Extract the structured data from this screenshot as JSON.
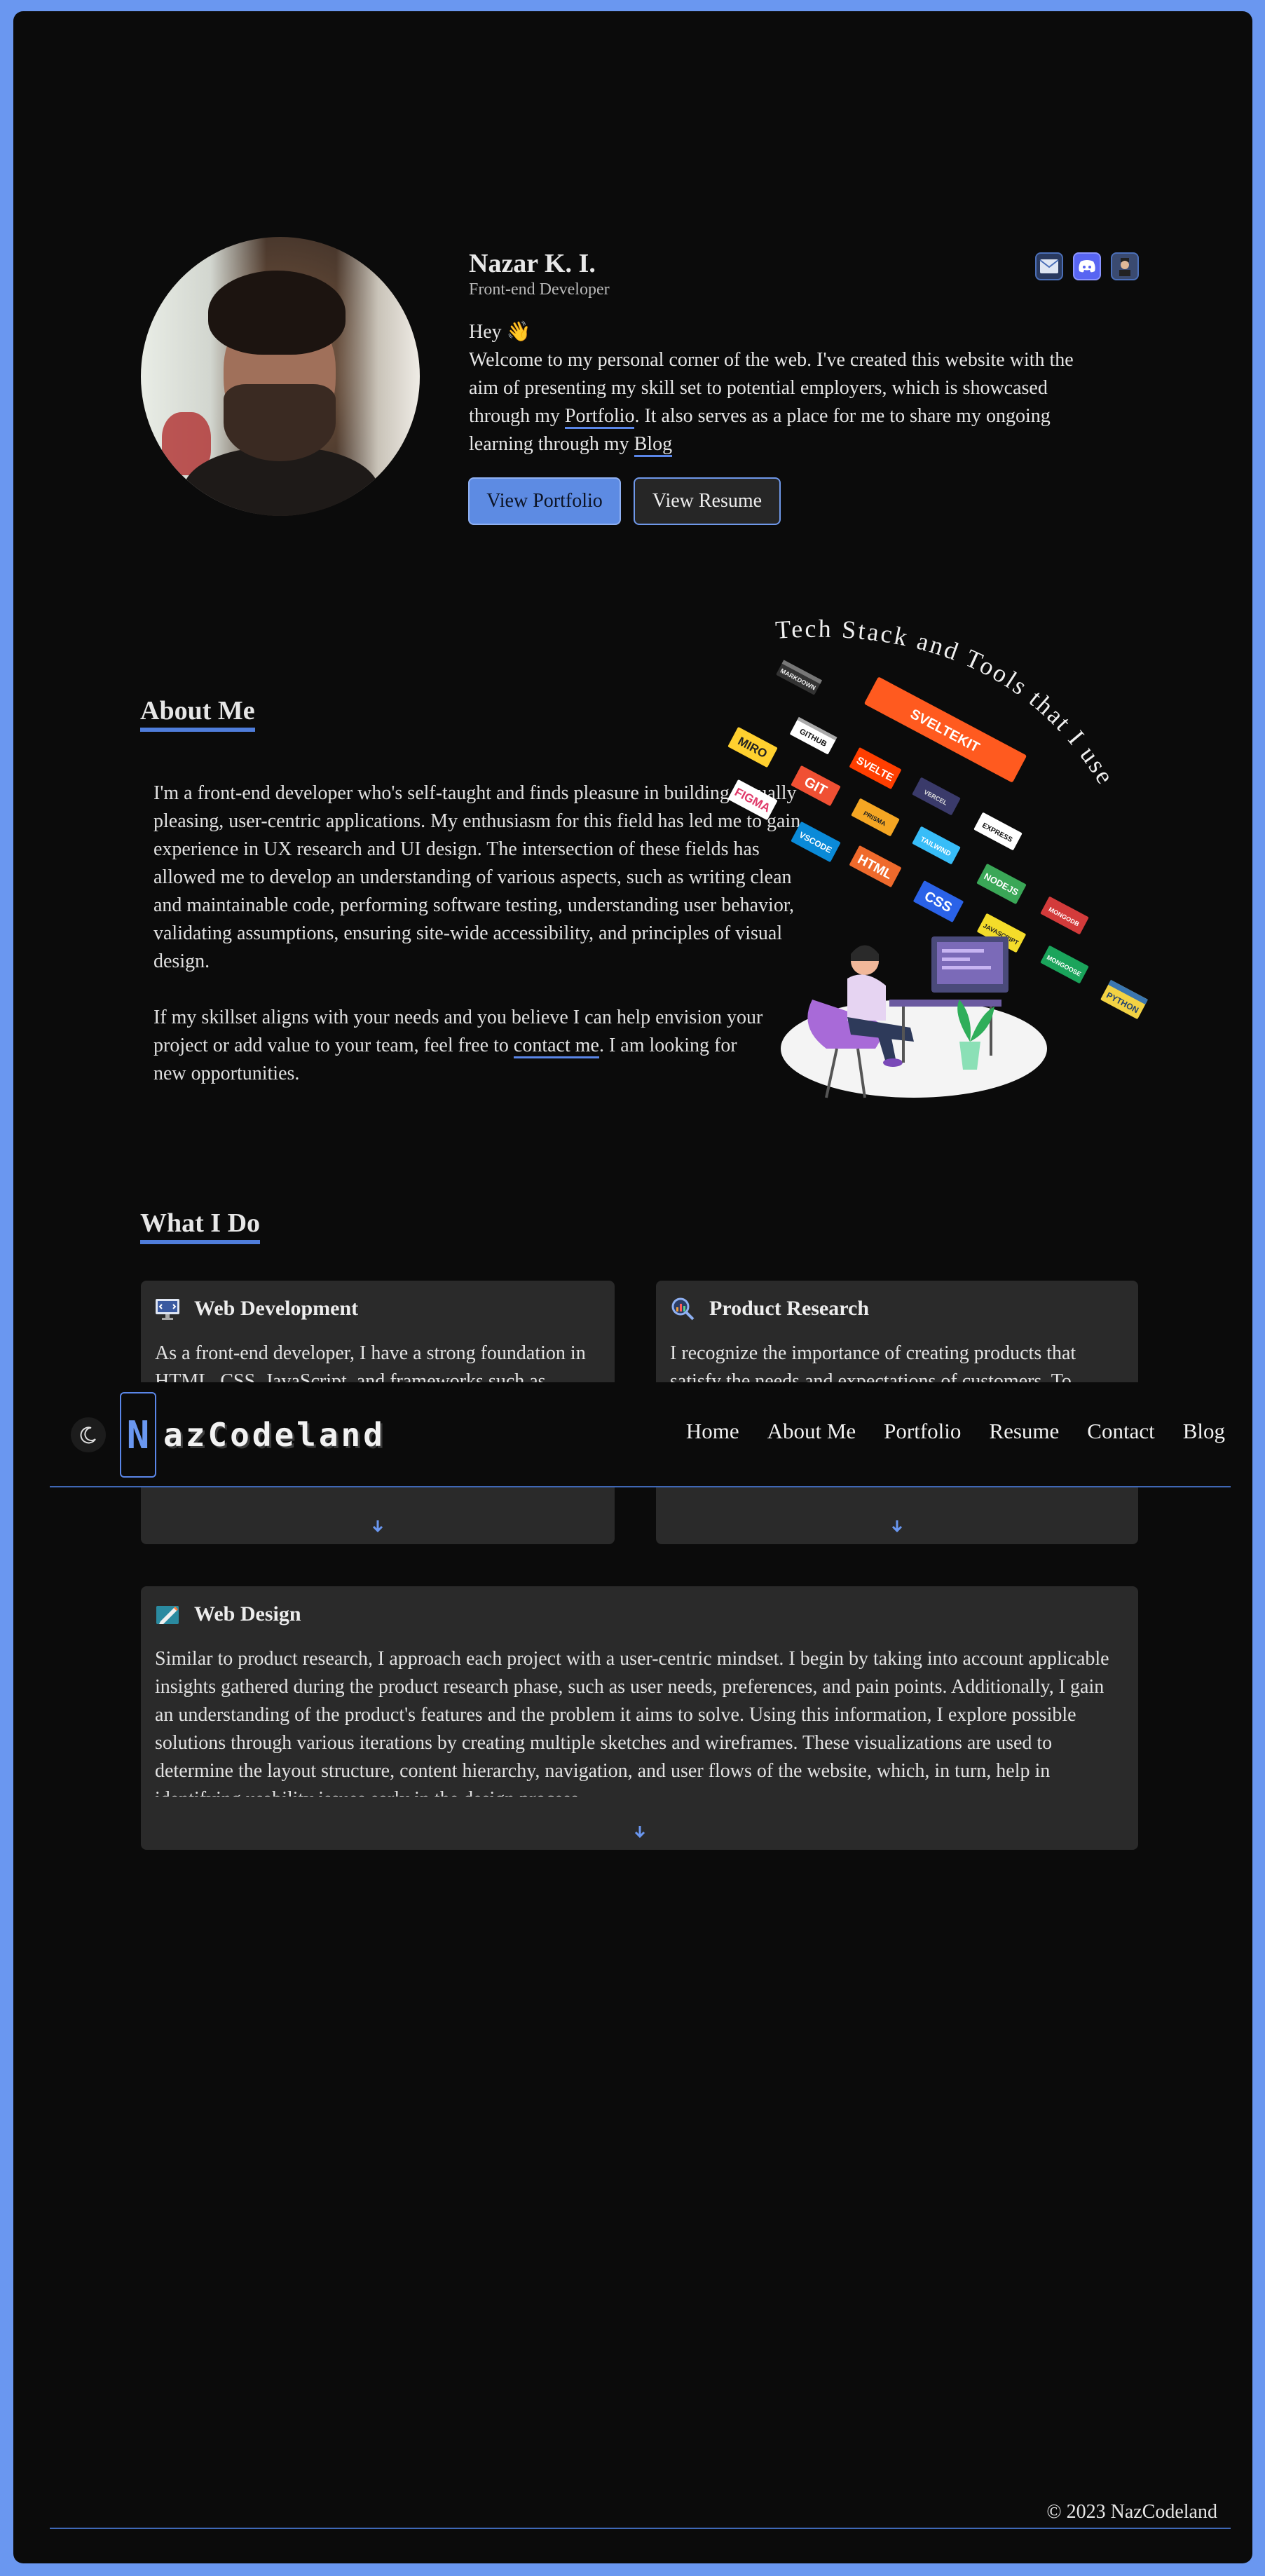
{
  "hero": {
    "name": "Nazar K. I.",
    "role": "Front-end Developer",
    "greeting": "Hey 👋",
    "intro_a": "Welcome to my personal corner of the web. I've created this website with the aim of presenting my skill set to potential employers, which is showcased through my ",
    "portfolio_link": "Portfolio",
    "intro_b": ". It also serves as a place for me to share my ongoing learning through my ",
    "blog_link": "Blog",
    "btn_portfolio": "View Portfolio",
    "btn_resume": "View Resume",
    "icons": [
      "mail-icon",
      "discord-icon",
      "github-avatar-icon"
    ]
  },
  "about": {
    "title": "About Me",
    "p1": "I'm a front-end developer who's self-taught and finds pleasure in building visually pleasing, user-centric applications. My enthusiasm for this field has led me to gain experience in UX research and UI design. The intersection of these fields has allowed me to develop an understanding of various aspects, such as writing clean and maintainable code, performing software testing, understanding user behavior, validating assumptions, ensuring site-wide accessibility, and principles of visual design.",
    "p2_a": "If my skillset aligns with your needs and you believe I can help envision your project or add value to your team, feel free to ",
    "p2_link": "contact me",
    "p2_b": ". I am looking for new opportunities.",
    "art_caption": "Tech Stack and Tools that I use",
    "tiles": [
      "MARKDOWN",
      "GITHUB",
      "SVELTEKIT",
      "MIRO",
      "SVELTE",
      "GIT",
      "VERCEL",
      "PRISMA",
      "FIGMA",
      "NETLIFY",
      "EXPRESS",
      "VSCODE",
      "HTML",
      "TAILWIND",
      "NODEJS",
      "CSS",
      "MONGODB",
      "JAVASCRIPT",
      "MONGOOSE",
      "PYTHON"
    ]
  },
  "whatido": {
    "title": "What I Do",
    "cards": [
      {
        "title": "Web Development",
        "body": "As a front-end developer, I have a strong foundation in HTML, CSS, JavaScript, and frameworks such as Svelte and SvelteKit. I strive to write clean and maintainable code, and ensure that the applications I build are visually appealing, accessible, and robust.",
        "icon": "monitor-code-icon"
      },
      {
        "title": "Product Research",
        "body": "I recognize the importance of creating products that satisfy the needs and expectations of customers. To achieve this, I conduct research to gain insights into the needs, expectations, and behaviors of the target audience.",
        "icon": "magnifier-chart-icon"
      },
      {
        "title": "Web Design",
        "body": "Similar to product research, I approach each project with a user-centric mindset. I begin by taking into account applicable insights gathered during the product research phase, such as user needs, preferences, and pain points. Additionally, I gain an understanding of the product's features and the problem it aims to solve. Using this information, I explore possible solutions through various iterations by creating multiple sketches and wireframes. These visualizations are used to determine the layout structure, content hierarchy, navigation, and user flows of the website, which, in turn, help in identifying usability issues early in the design process.",
        "icon": "pen-design-icon"
      }
    ]
  },
  "nav": {
    "logo_first": "N",
    "logo_rest": "azCodeland",
    "links": [
      "Home",
      "About Me",
      "Portfolio",
      "Resume",
      "Contact",
      "Blog"
    ]
  },
  "footer": {
    "text": "© 2023 NazCodeland"
  }
}
